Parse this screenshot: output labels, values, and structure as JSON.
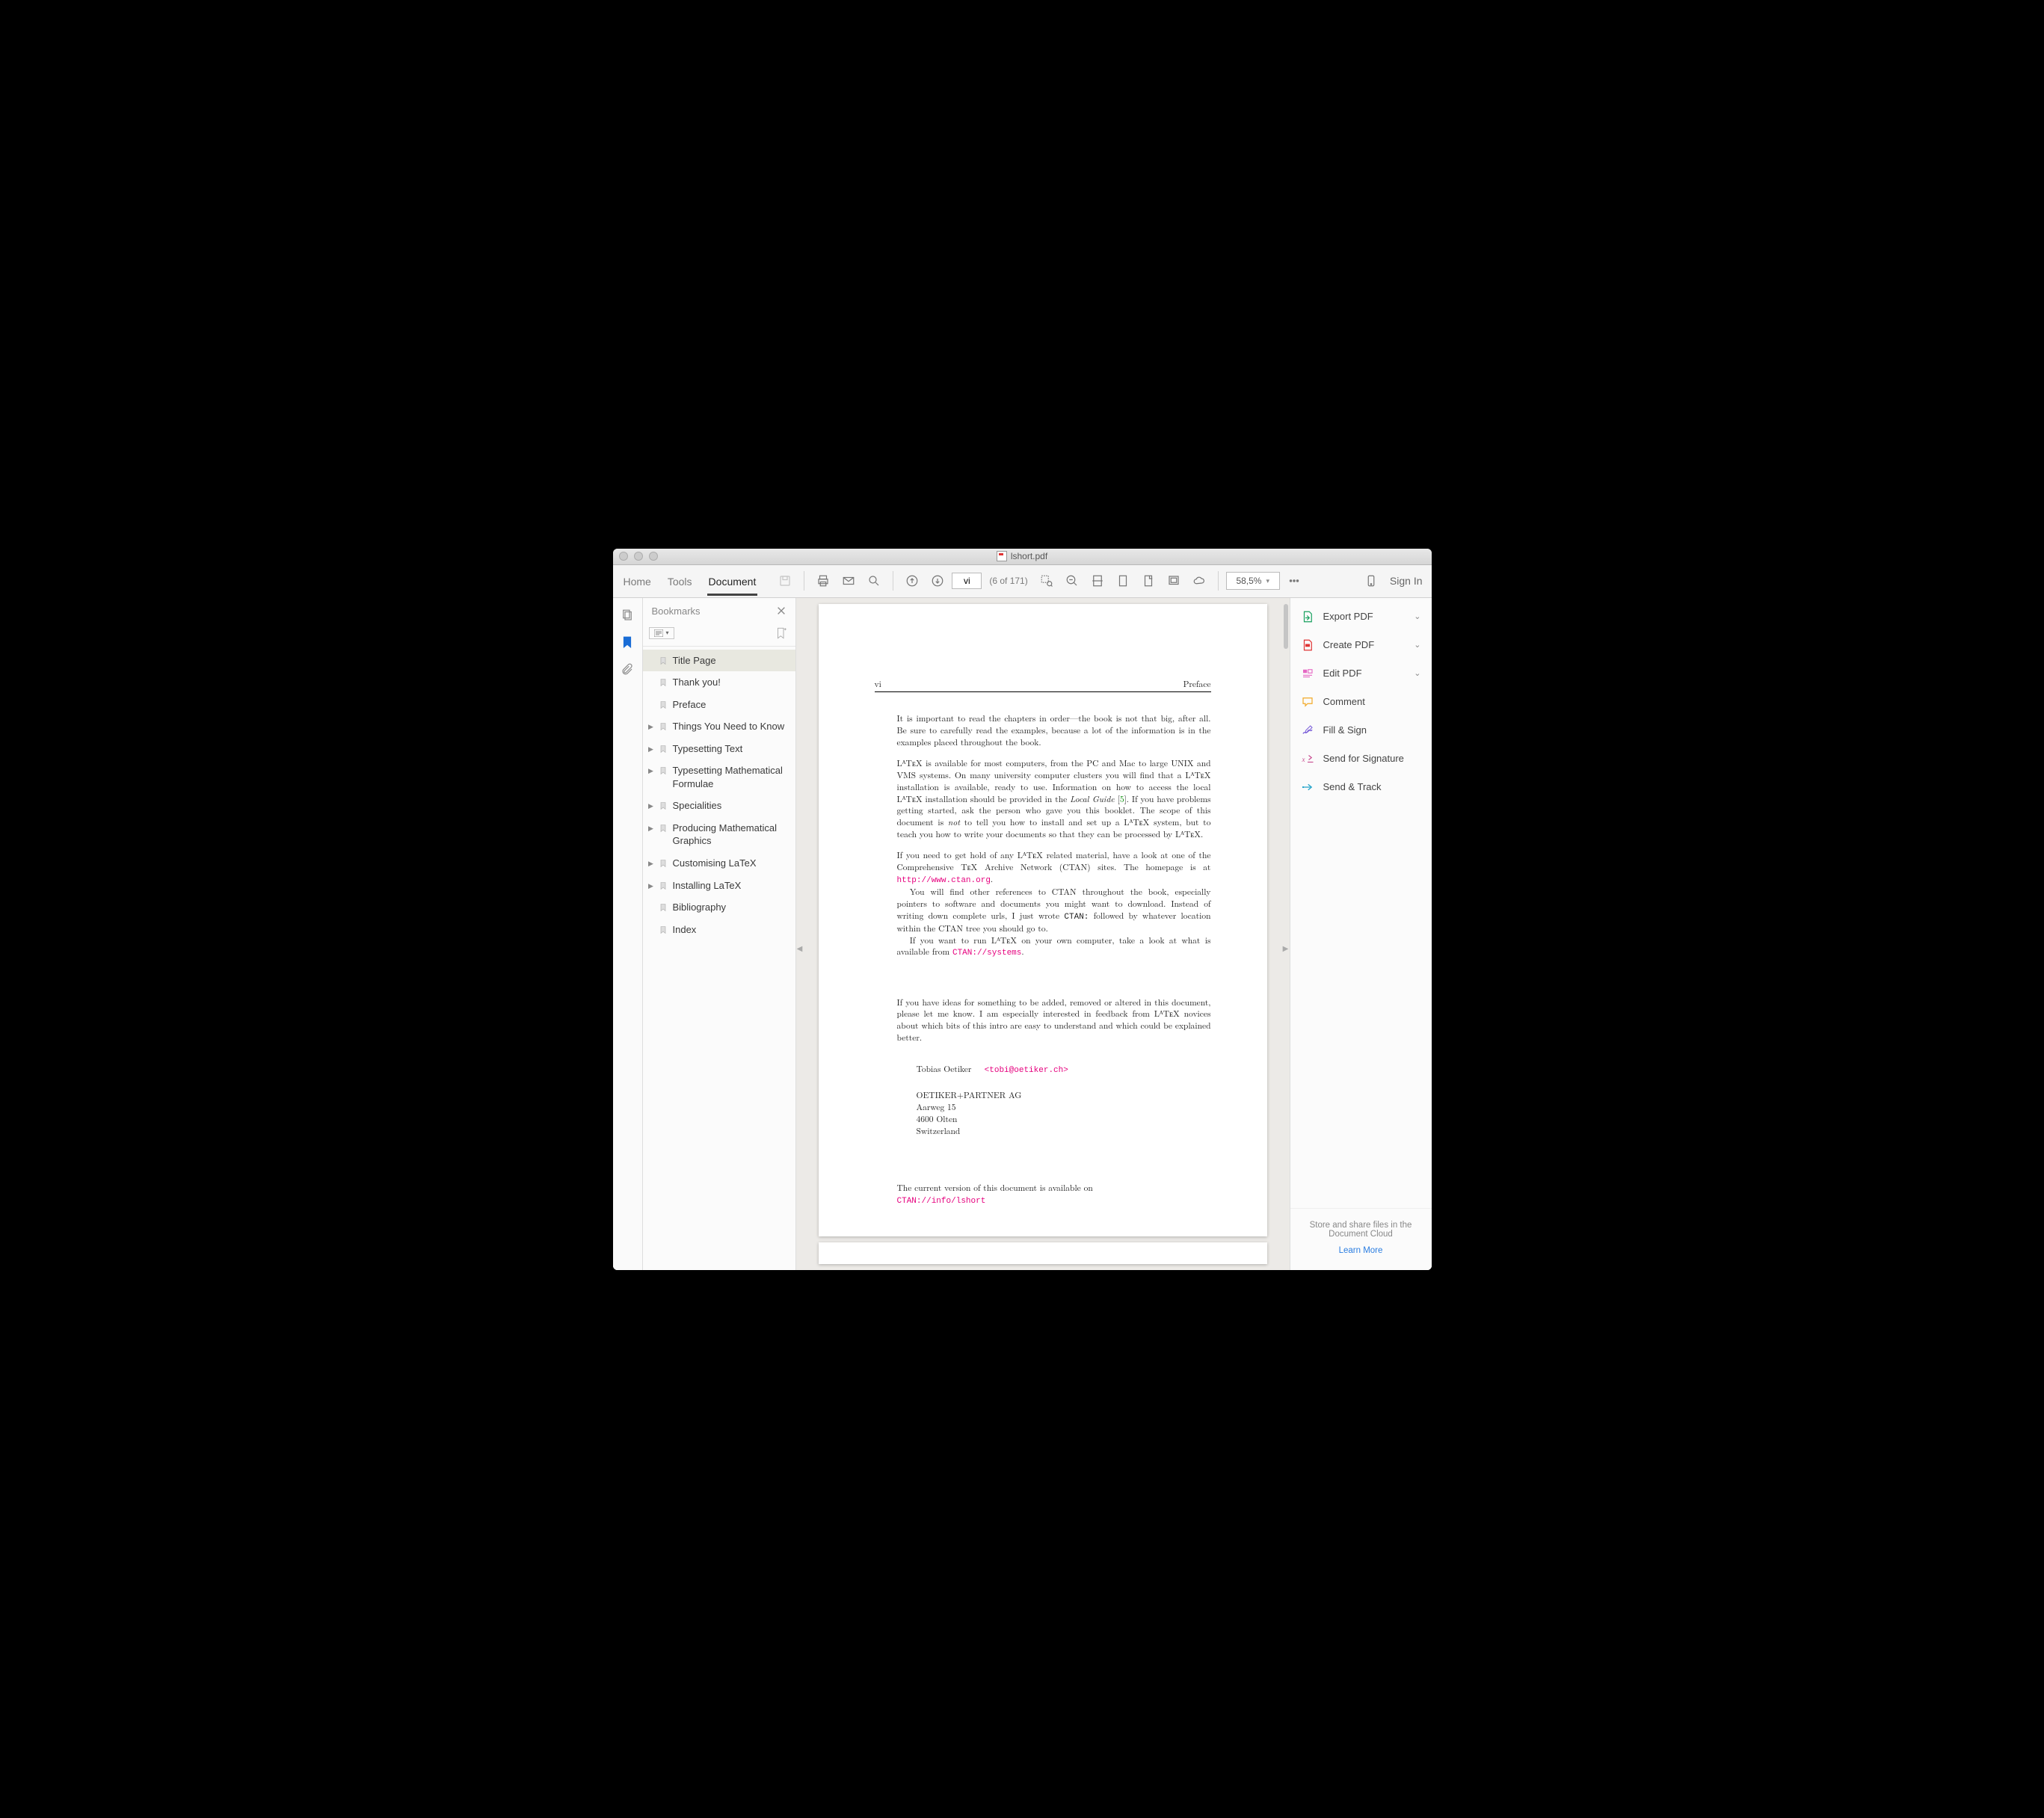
{
  "window": {
    "title": "lshort.pdf"
  },
  "toolbar": {
    "tabs": {
      "home": "Home",
      "tools": "Tools",
      "document": "Document"
    },
    "page_value": "vi",
    "page_of": "(6 of 171)",
    "zoom": "58,5%",
    "sign_in": "Sign In"
  },
  "bookmarks": {
    "title": "Bookmarks",
    "items": [
      {
        "label": "Title Page",
        "expandable": false,
        "selected": true
      },
      {
        "label": "Thank you!",
        "expandable": false
      },
      {
        "label": "Preface",
        "expandable": false
      },
      {
        "label": "Things You Need to Know",
        "expandable": true
      },
      {
        "label": "Typesetting Text",
        "expandable": true
      },
      {
        "label": "Typesetting Mathematical Formulae",
        "expandable": true
      },
      {
        "label": "Specialities",
        "expandable": true
      },
      {
        "label": "Producing Mathematical Graphics",
        "expandable": true
      },
      {
        "label": "Customising LaTeX",
        "expandable": true
      },
      {
        "label": "Installing LaTeX",
        "expandable": true
      },
      {
        "label": "Bibliography",
        "expandable": false
      },
      {
        "label": "Index",
        "expandable": false
      }
    ]
  },
  "document": {
    "running_left": "vi",
    "running_right": "Preface",
    "para1": "It is important to read the chapters in order—the book is not that big, after all. Be sure to carefully read the examples, because a lot of the information is in the examples placed throughout the book.",
    "para2a": "LᴬTᴇX is available for most computers, from the PC and Mac to large UNIX and VMS systems. On many university computer clusters you will find that a LᴬTᴇX installation is available, ready to use. Information on how to access the local LᴬTᴇX installation should be provided in the ",
    "para2_localguide": "Local Guide",
    "para2_ref": "5",
    "para2b": ". If you have problems getting started, ask the person who gave you this booklet. The scope of this document is ",
    "para2_not": "not",
    "para2c": " to tell you how to install and set up a LᴬTᴇX system, but to teach you how to write your documents so that they can be processed by LᴬTᴇX.",
    "para3a": "If you need to get hold of any LᴬTᴇX related material, have a look at one of the Comprehensive TᴇX Archive Network (CTAN) sites. The homepage is at ",
    "para3_url": "http://www.ctan.org",
    "para3b": ".",
    "para4a": "You will find other references to CTAN throughout the book, especially pointers to software and documents you might want to download. Instead of writing down complete urls, I just wrote ",
    "para4_ctan": "CTAN:",
    "para4b": " followed by whatever location within the CTAN tree you should go to.",
    "para5a": "If you want to run LᴬTᴇX on your own computer, take a look at what is available from ",
    "para5_url": "CTAN://systems",
    "para5b": ".",
    "para6": "If you have ideas for something to be added, removed or altered in this document, please let me know. I am especially interested in feedback from LᴬTᴇX novices about which bits of this intro are easy to understand and which could be explained better.",
    "author_name": "Tobias Oetiker",
    "author_email": "<tobi@oetiker.ch>",
    "addr1": "OETIKER+PARTNER AG",
    "addr2": "Aarweg 15",
    "addr3": "4600 Olten",
    "addr4": "Switzerland",
    "avail_text": "The current version of this document is available on",
    "avail_url": "CTAN://info/lshort"
  },
  "right_panel": {
    "items": [
      {
        "label": "Export PDF",
        "icon": "export",
        "chevron": true
      },
      {
        "label": "Create PDF",
        "icon": "create",
        "chevron": true
      },
      {
        "label": "Edit PDF",
        "icon": "edit",
        "chevron": true
      },
      {
        "label": "Comment",
        "icon": "comment",
        "chevron": false
      },
      {
        "label": "Fill & Sign",
        "icon": "fillsign",
        "chevron": false
      },
      {
        "label": "Send for Signature",
        "icon": "sendforsig",
        "chevron": false
      },
      {
        "label": "Send & Track",
        "icon": "sendtrack",
        "chevron": false
      }
    ],
    "footer_text": "Store and share files in the Document Cloud",
    "footer_link": "Learn More"
  }
}
